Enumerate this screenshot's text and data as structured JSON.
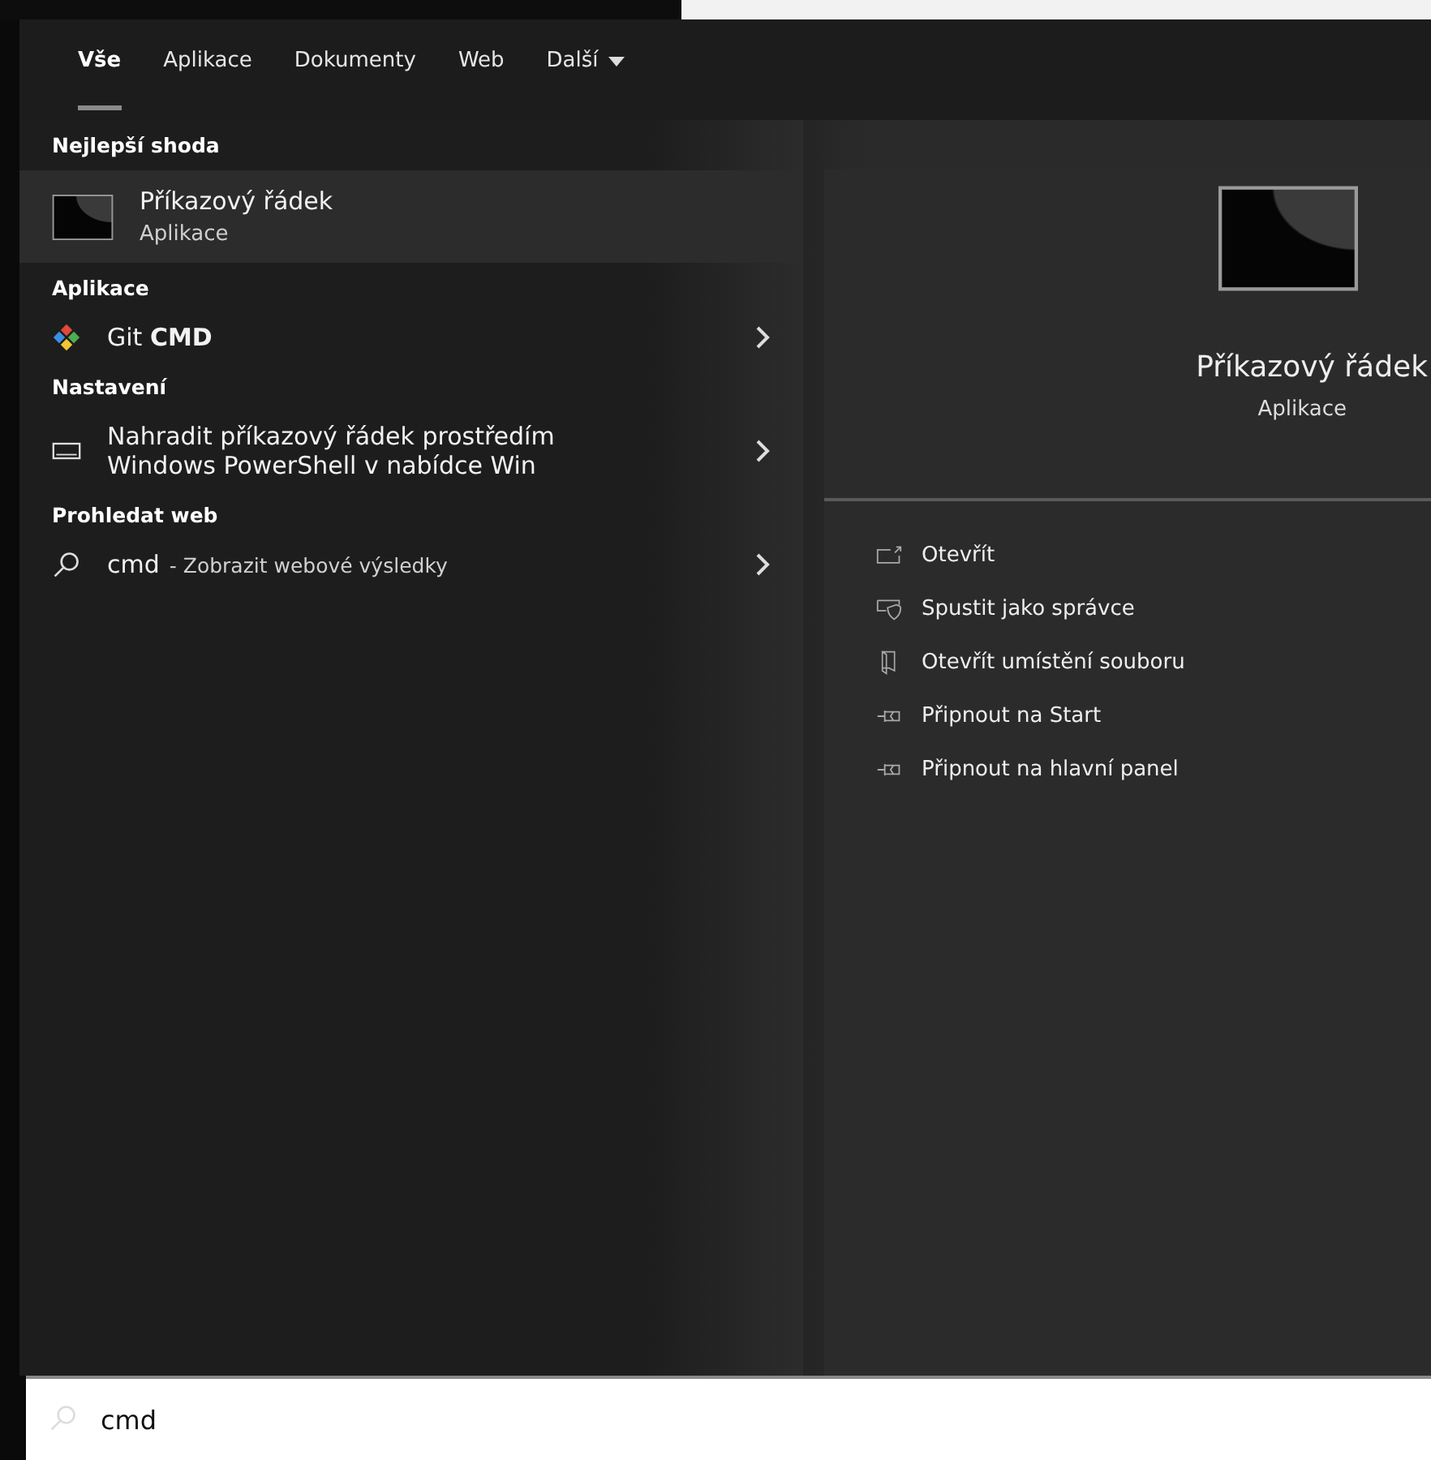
{
  "tabs": [
    {
      "label": "Vše",
      "selected": true
    },
    {
      "label": "Aplikace",
      "selected": false
    },
    {
      "label": "Dokumenty",
      "selected": false
    },
    {
      "label": "Web",
      "selected": false
    },
    {
      "label": "Další",
      "selected": false,
      "kind": "dropdown"
    }
  ],
  "sections": [
    {
      "title": "Nejlepší shoda",
      "items": [
        {
          "kind": "best",
          "title": "Příkazový řádek",
          "subtitle": "Aplikace",
          "selected": true
        }
      ]
    },
    {
      "title": "Aplikace",
      "items": [
        {
          "kind": "app",
          "title": "Git **CMD**",
          "selected": false
        }
      ]
    },
    {
      "title": "Nastavení",
      "items": [
        {
          "kind": "setting",
          "title": "Nahradit příkazový řádek prostředím Windows PowerShell v nabídce Win",
          "selected": false
        }
      ]
    },
    {
      "title": "Prohledat web",
      "items": [
        {
          "kind": "web",
          "query": "cmd",
          "suffix": "- Zobrazit webové výsledky",
          "selected": false
        }
      ]
    }
  ],
  "preview": {
    "title": "Příkazový řádek",
    "subtitle": "Aplikace",
    "actions": [
      {
        "label": "Otevřít"
      },
      {
        "label": "Spustit jako správce"
      },
      {
        "label": "Otevřít umístění souboru"
      },
      {
        "label": "Připnout na Start"
      },
      {
        "label": "Připnout na hlavní panel"
      }
    ]
  },
  "search": {
    "value": "cmd"
  }
}
